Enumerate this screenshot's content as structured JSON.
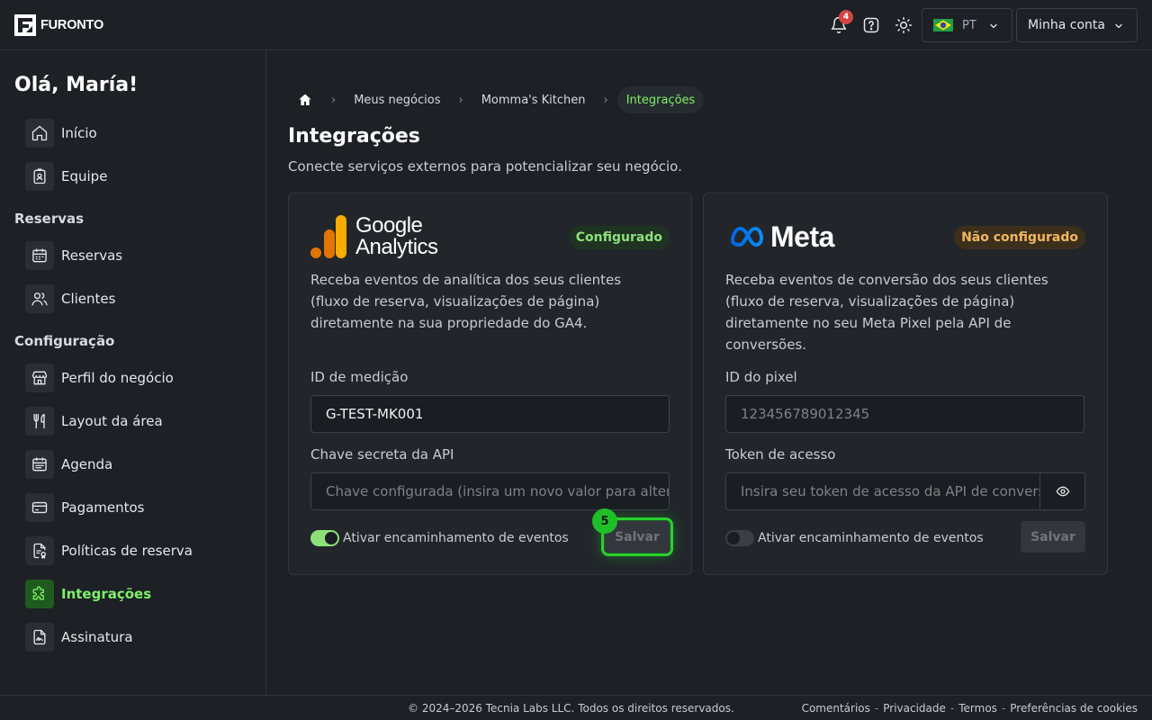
{
  "app": {
    "name": "FURONTO"
  },
  "topbar": {
    "notifications_count": "4",
    "language": "PT",
    "account_label": "Minha conta"
  },
  "sidebar": {
    "greeting": "Olá, María!",
    "sections": {
      "reservas": "Reservas",
      "configuracao": "Configuração"
    },
    "items": {
      "inicio": "Início",
      "equipe": "Equipe",
      "reservas": "Reservas",
      "clientes": "Clientes",
      "perfil": "Perfil do negócio",
      "layout": "Layout da área",
      "agenda": "Agenda",
      "pagamentos": "Pagamentos",
      "politicas": "Políticas de reserva",
      "integracoes": "Integrações",
      "assinatura": "Assinatura"
    }
  },
  "breadcrumb": {
    "items": [
      "Meus negócios",
      "Momma's Kitchen",
      "Integrações"
    ]
  },
  "page": {
    "title": "Integrações",
    "subtitle": "Conecte serviços externos para potencializar seu negócio."
  },
  "google": {
    "logo_line1": "Google",
    "logo_line2": "Analytics",
    "status": "Configurado",
    "description": "Receba eventos de analítica dos seus clientes (fluxo de reserva, visualizações de página) diretamente na sua propriedade do GA4.",
    "id_label": "ID de medição",
    "id_value": "G-TEST-MK001",
    "secret_label": "Chave secreta da API",
    "secret_placeholder": "Chave configurada (insira um novo valor para alterar)",
    "toggle_label": "Ativar encaminhamento de eventos",
    "toggle_on": true,
    "save_label": "Salvar",
    "step_number": "5"
  },
  "meta": {
    "logo_text": "Meta",
    "status": "Não configurado",
    "description": "Receba eventos de conversão dos seus clientes (fluxo de reserva, visualizações de página) diretamente no seu Meta Pixel pela API de conversões.",
    "pixel_label": "ID do pixel",
    "pixel_placeholder": "123456789012345",
    "token_label": "Token de acesso",
    "token_placeholder": "Insira seu token de acesso da API de conversões",
    "toggle_label": "Ativar encaminhamento de eventos",
    "toggle_on": false,
    "save_label": "Salvar"
  },
  "footer": {
    "copyright": "© 2024–2026 Tecnia Labs LLC. Todos os direitos reservados.",
    "links": [
      "Comentários",
      "Privacidade",
      "Termos",
      "Preferências de cookies"
    ],
    "separator": "-"
  },
  "colors": {
    "accent": "#7ef06a",
    "status_ok": "#8ee07a",
    "status_warn": "#f4b661",
    "highlight": "#27d12c"
  }
}
